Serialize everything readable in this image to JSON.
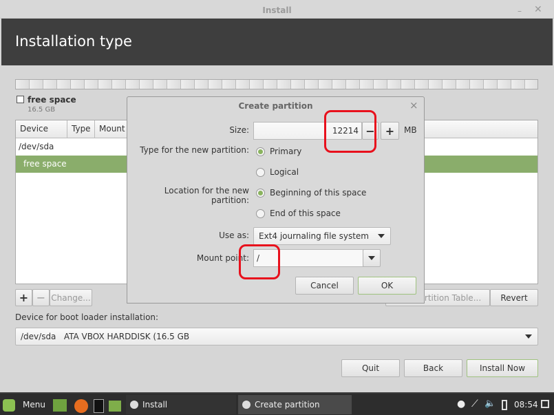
{
  "window": {
    "title": "Install",
    "minimize_icon": "minimize-icon",
    "close_icon": "close-icon"
  },
  "header": {
    "title": "Installation type"
  },
  "partition_legend": {
    "label": "free space",
    "size": "16.5 GB"
  },
  "table": {
    "columns": [
      "Device",
      "Type",
      "Mount"
    ],
    "rows": [
      {
        "device": "/dev/sda",
        "selected": false
      },
      {
        "device": "free space",
        "selected": true
      }
    ],
    "selection_color": "#8aad6b"
  },
  "table_buttons": {
    "add": "+",
    "remove": "−",
    "change": "Change...",
    "new_table": "New Partition Table...",
    "revert": "Revert"
  },
  "boot_loader": {
    "label": "Device for boot loader installation:",
    "value": "/dev/sda   ATA VBOX HARDDISK (16.5 GB"
  },
  "footer": {
    "quit": "Quit",
    "back": "Back",
    "install": "Install Now"
  },
  "dialog": {
    "title": "Create partition",
    "close": "×",
    "size_label": "Size:",
    "size_value": "12214",
    "minus": "−",
    "plus": "+",
    "unit": "MB",
    "type_label": "Type for the new partition:",
    "type_options": [
      {
        "label": "Primary",
        "selected": true
      },
      {
        "label": "Logical",
        "selected": false
      }
    ],
    "location_label": "Location for the new partition:",
    "location_options": [
      {
        "label": "Beginning of this space",
        "selected": true
      },
      {
        "label": "End of this space",
        "selected": false
      }
    ],
    "use_as_label": "Use as:",
    "use_as_value": "Ext4 journaling file system",
    "mount_label": "Mount point:",
    "mount_value": "/",
    "cancel": "Cancel",
    "ok": "OK"
  },
  "taskbar": {
    "menu": "Menu",
    "windows": [
      {
        "label": "Install",
        "active": false
      },
      {
        "label": "Create partition",
        "active": true
      }
    ],
    "clock": "08:54"
  },
  "accent_color": "#8ab35e",
  "annotation_color": "#e8101c"
}
